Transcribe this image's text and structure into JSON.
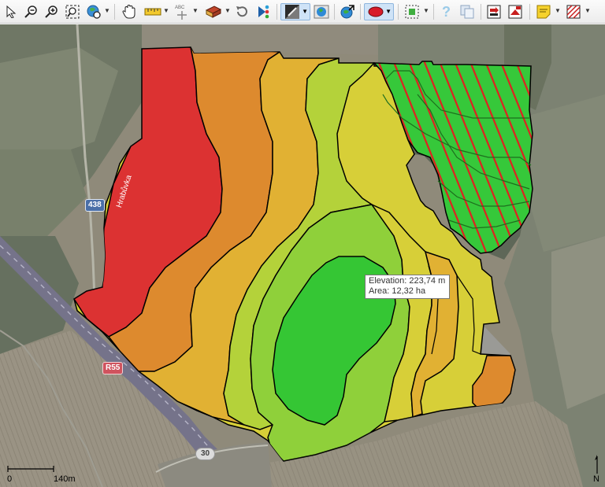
{
  "toolbar": {
    "items": [
      {
        "name": "select-tool"
      },
      {
        "name": "zoom-out"
      },
      {
        "name": "zoom-in"
      },
      {
        "name": "zoom-extent"
      },
      {
        "name": "globe-zoom"
      },
      {
        "name": "pan-hand"
      },
      {
        "name": "measure-ruler"
      },
      {
        "name": "label-tool"
      },
      {
        "name": "layer-book"
      },
      {
        "name": "undo"
      },
      {
        "name": "share"
      },
      {
        "name": "elevation-layer"
      },
      {
        "name": "globe-layer"
      },
      {
        "name": "globe-arrow"
      },
      {
        "name": "ellipse-shape"
      },
      {
        "name": "select-frame"
      },
      {
        "name": "help"
      },
      {
        "name": "copy"
      },
      {
        "name": "export-a"
      },
      {
        "name": "export-b"
      },
      {
        "name": "note"
      },
      {
        "name": "hatch-pattern"
      }
    ]
  },
  "tooltip": {
    "elevation": "Elevation: 223,74 m",
    "area": "Area: 12,32 ha"
  },
  "scale": {
    "start": "0",
    "end": "140m"
  },
  "north": "N",
  "road_labels": {
    "r438": "438",
    "r55": "R55",
    "r30": "30",
    "street": "Hrabůvka"
  },
  "colors": {
    "red": "#dc3232",
    "orange": "#dd8a2e",
    "amber": "#e1b133",
    "yellow": "#d7cf38",
    "lime": "#b4d23a",
    "lightgreen": "#8fd03a",
    "green": "#35c634",
    "hatch": "#e02020"
  }
}
